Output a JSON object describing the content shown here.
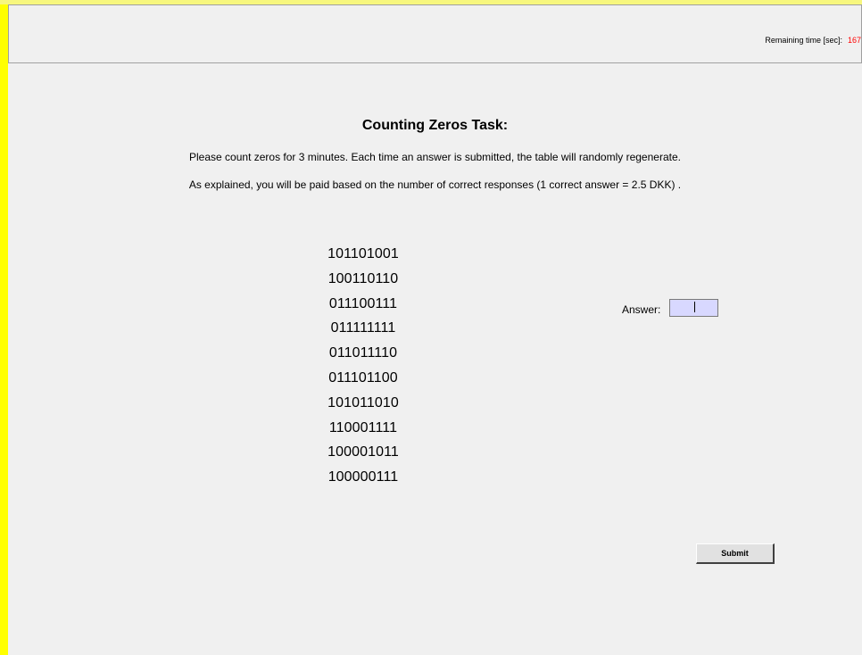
{
  "header": {
    "timer_label": "Remaining time [sec]:",
    "timer_value": "167"
  },
  "task": {
    "title": "Counting Zeros Task:",
    "instruction_1": "Please count zeros for 3 minutes. Each time an answer is submitted, the table will randomly regenerate.",
    "instruction_2": "As explained, you will be paid based on the number of correct responses (1 correct answer = 2.5 DKK) ."
  },
  "grid": {
    "rows": [
      "101101001",
      "100110110",
      "011100111",
      "011111111",
      "011011110",
      "011101100",
      "101011010",
      "110001111",
      "100001011",
      "100000111"
    ]
  },
  "answer": {
    "label": "Answer:",
    "value": ""
  },
  "submit": {
    "label": "Submit"
  },
  "colors": {
    "frame": "#ffff00",
    "background": "#f0f0f0",
    "input_background": "#d8d8ff",
    "timer_value": "#ff0000"
  }
}
